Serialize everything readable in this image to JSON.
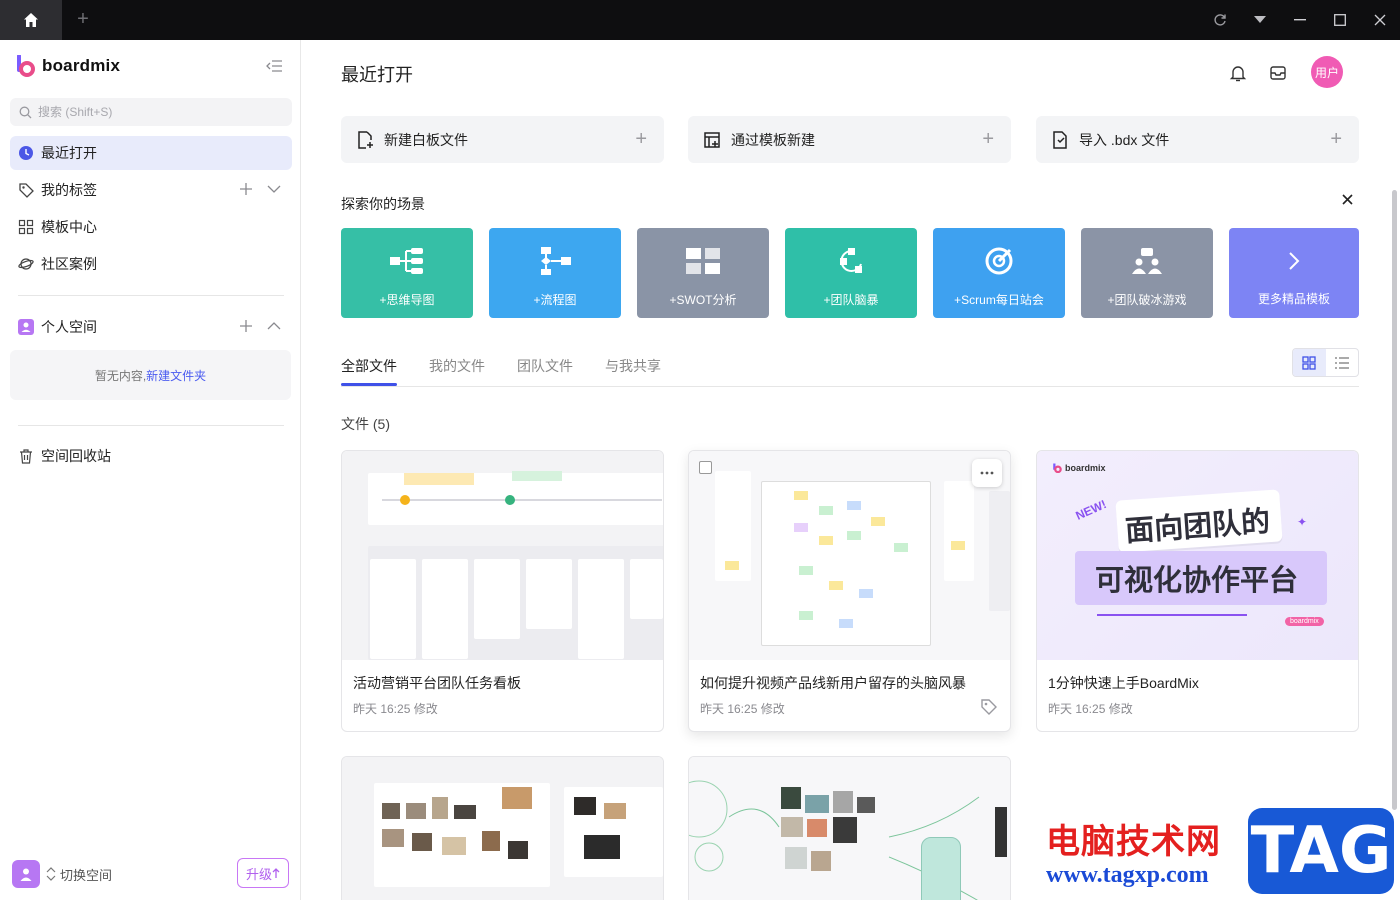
{
  "titlebar": {
    "new_tab_symbol": "+"
  },
  "sidebar": {
    "logo_text": "boardmix",
    "search_placeholder": "搜索 (Shift+S)",
    "nav": [
      {
        "label": "最近打开"
      },
      {
        "label": "我的标签"
      },
      {
        "label": "模板中心"
      },
      {
        "label": "社区案例"
      }
    ],
    "personal_space": "个人空间",
    "empty_text": "暂无内容,",
    "empty_link": "新建文件夹",
    "trash": "空间回收站",
    "switch_space": "切换空间",
    "upgrade": "升级"
  },
  "header": {
    "title": "最近打开",
    "user_label": "用户"
  },
  "actions": [
    {
      "label": "新建白板文件"
    },
    {
      "label": "通过模板新建"
    },
    {
      "label": "导入 .bdx 文件"
    }
  ],
  "scenes_title": "探索你的场景",
  "scenes": [
    {
      "label": "+思维导图",
      "color": "#36bfa6",
      "icon": "mindmap-icon"
    },
    {
      "label": "+流程图",
      "color": "#3da7f0",
      "icon": "flowchart-icon"
    },
    {
      "label": "+SWOT分析",
      "color": "#8a94a6",
      "icon": "swot-icon"
    },
    {
      "label": "+团队脑暴",
      "color": "#2fbfa8",
      "icon": "brainstorm-icon"
    },
    {
      "label": "+Scrum每日站会",
      "color": "#3ea1f0",
      "icon": "scrum-icon"
    },
    {
      "label": "+团队破冰游戏",
      "color": "#8b94a6",
      "icon": "team-icon"
    },
    {
      "label": "更多精品模板",
      "color": "#7d84f4",
      "icon": "chevron-right-icon"
    }
  ],
  "tabs": [
    "全部文件",
    "我的文件",
    "团队文件",
    "与我共享"
  ],
  "files_count": "文件 (5)",
  "files": [
    {
      "name": "活动营销平台团队任务看板",
      "meta": "昨天 16:25 修改"
    },
    {
      "name": "如何提升视频产品线新用户留存的头脑风暴",
      "meta": "昨天 16:25 修改"
    },
    {
      "name": "1分钟快速上手BoardMix",
      "meta": "昨天 16:25 修改"
    }
  ],
  "promo": {
    "brand": "boardmix",
    "new_badge": "NEW!",
    "line1": "面向团队的",
    "line2": "可视化协作平台",
    "tag": "boardmix"
  },
  "watermark": {
    "cn": "电脑技术网",
    "url": "www.tagxp.com",
    "tag": "TAG"
  },
  "colors": {
    "accent": "#3f51e8",
    "avatar": "#f05bb4",
    "upgrade": "#b160ee"
  }
}
